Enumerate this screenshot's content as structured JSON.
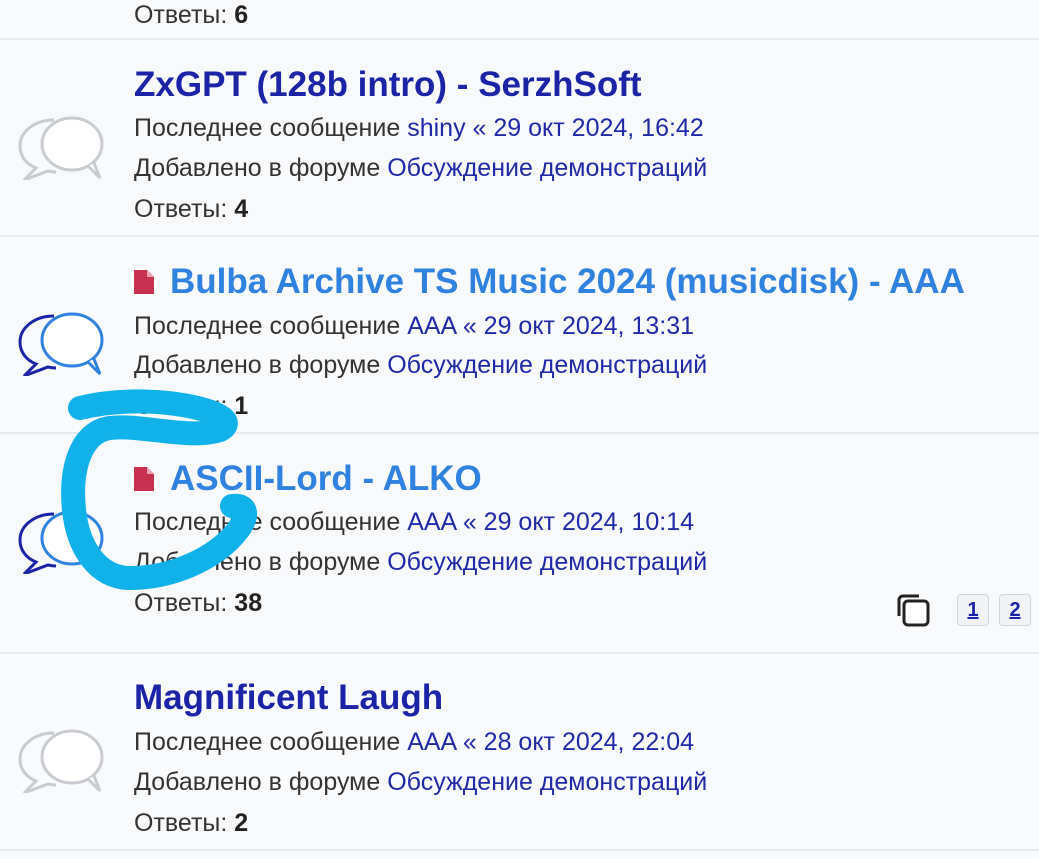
{
  "colors": {
    "link_read": "#1a24a6",
    "link_unread": "#2f82df",
    "meta_link": "#1f2aa8",
    "paper_icon": "#c8314f",
    "bubble_read": "#c8cbcf",
    "bubble_unread": "#2f82df",
    "highlight_stroke": "#11b2ea"
  },
  "labels": {
    "last_post": "Последнее сообщение",
    "posted_in": "Добавлено в форуме",
    "replies": "Ответы:",
    "separator": "«"
  },
  "top_partial": {
    "replies_label": "Ответы:",
    "replies": "6"
  },
  "topics": [
    {
      "title": "ZxGPT (128b intro) - SerzhSoft",
      "unread": false,
      "icon": "read-topic-bubbles-icon",
      "last_author": "shiny",
      "last_time": "29 окт 2024, 16:42",
      "forum": "Обсуждение демонстраций",
      "replies": "4"
    },
    {
      "title": "Bulba Archive TS Music 2024 (musicdisk) - AAA",
      "unread": true,
      "icon": "unread-topic-bubbles-icon",
      "last_author": "AAA",
      "last_time": "29 окт 2024, 13:31",
      "forum": "Обсуждение демонстраций",
      "replies": "1"
    },
    {
      "title": "ASCII-Lord - ALKO",
      "unread": true,
      "icon": "unread-topic-bubbles-icon",
      "last_author": "AAA",
      "last_time": "29 окт 2024, 10:14",
      "forum": "Обсуждение демонстраций",
      "replies": "38",
      "pages": [
        "1",
        "2"
      ]
    },
    {
      "title": "Magnificent Laugh",
      "unread": false,
      "icon": "read-topic-bubbles-icon",
      "last_author": "AAA",
      "last_time": "28 окт 2024, 22:04",
      "forum": "Обсуждение демонстраций",
      "replies": "2"
    }
  ]
}
